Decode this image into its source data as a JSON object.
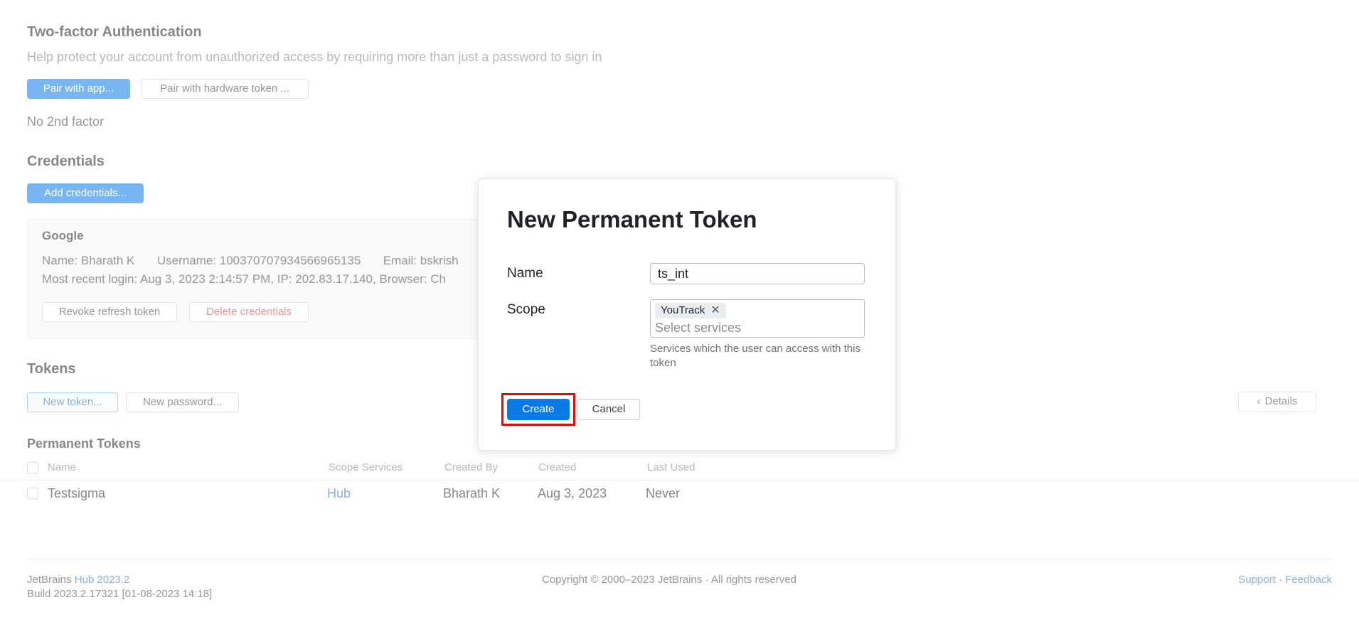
{
  "two_factor": {
    "title": "Two-factor Authentication",
    "description": "Help protect your account from unauthorized access by requiring more than just a password to sign in",
    "pair_app_label": "Pair with app...",
    "pair_hw_label": "Pair with hardware token ...",
    "status": "No 2nd factor"
  },
  "credentials": {
    "title": "Credentials",
    "add_label": "Add credentials...",
    "card": {
      "provider": "Google",
      "name": "Name: Bharath K",
      "username": "Username: 100370707934566965135",
      "email": "Email: bskrish",
      "recent_login": "Most recent login: Aug 3, 2023 2:14:57 PM, IP: 202.83.17.140, Browser: Ch",
      "revoke_label": "Revoke refresh token",
      "delete_label": "Delete credentials"
    }
  },
  "tokens": {
    "title": "Tokens",
    "new_token_label": "New token...",
    "new_password_label": "New password...",
    "details_label": "Details",
    "permanent_title": "Permanent Tokens",
    "columns": [
      "Name",
      "Scope Services",
      "Created By",
      "Created",
      "Last Used"
    ],
    "rows": [
      {
        "name": "Testsigma",
        "scope": "Hub",
        "created_by": "Bharath K",
        "created": "Aug 3, 2023",
        "last_used": "Never"
      }
    ]
  },
  "footer": {
    "brand": "JetBrains",
    "product": "Hub 2023.2",
    "build": "Build 2023.2.17321 [01-08-2023 14:18]",
    "copyright": "Copyright © 2000–2023 JetBrains · All rights reserved",
    "support": "Support",
    "separator": "·",
    "feedback": "Feedback"
  },
  "dialog": {
    "title": "New Permanent Token",
    "name_label": "Name",
    "name_value": "ts_int",
    "scope_label": "Scope",
    "scope_tag": "YouTrack",
    "scope_placeholder": "Select services",
    "scope_hint": "Services which the user can access with this token",
    "create_label": "Create",
    "cancel_label": "Cancel"
  },
  "icons": {
    "tag_remove": "close-icon",
    "details_chevron": "chevron-left-icon"
  },
  "colors": {
    "primary": "#0a7ae6",
    "link": "#2b6db3",
    "danger": "#c94040",
    "highlight": "#e10b0b"
  }
}
